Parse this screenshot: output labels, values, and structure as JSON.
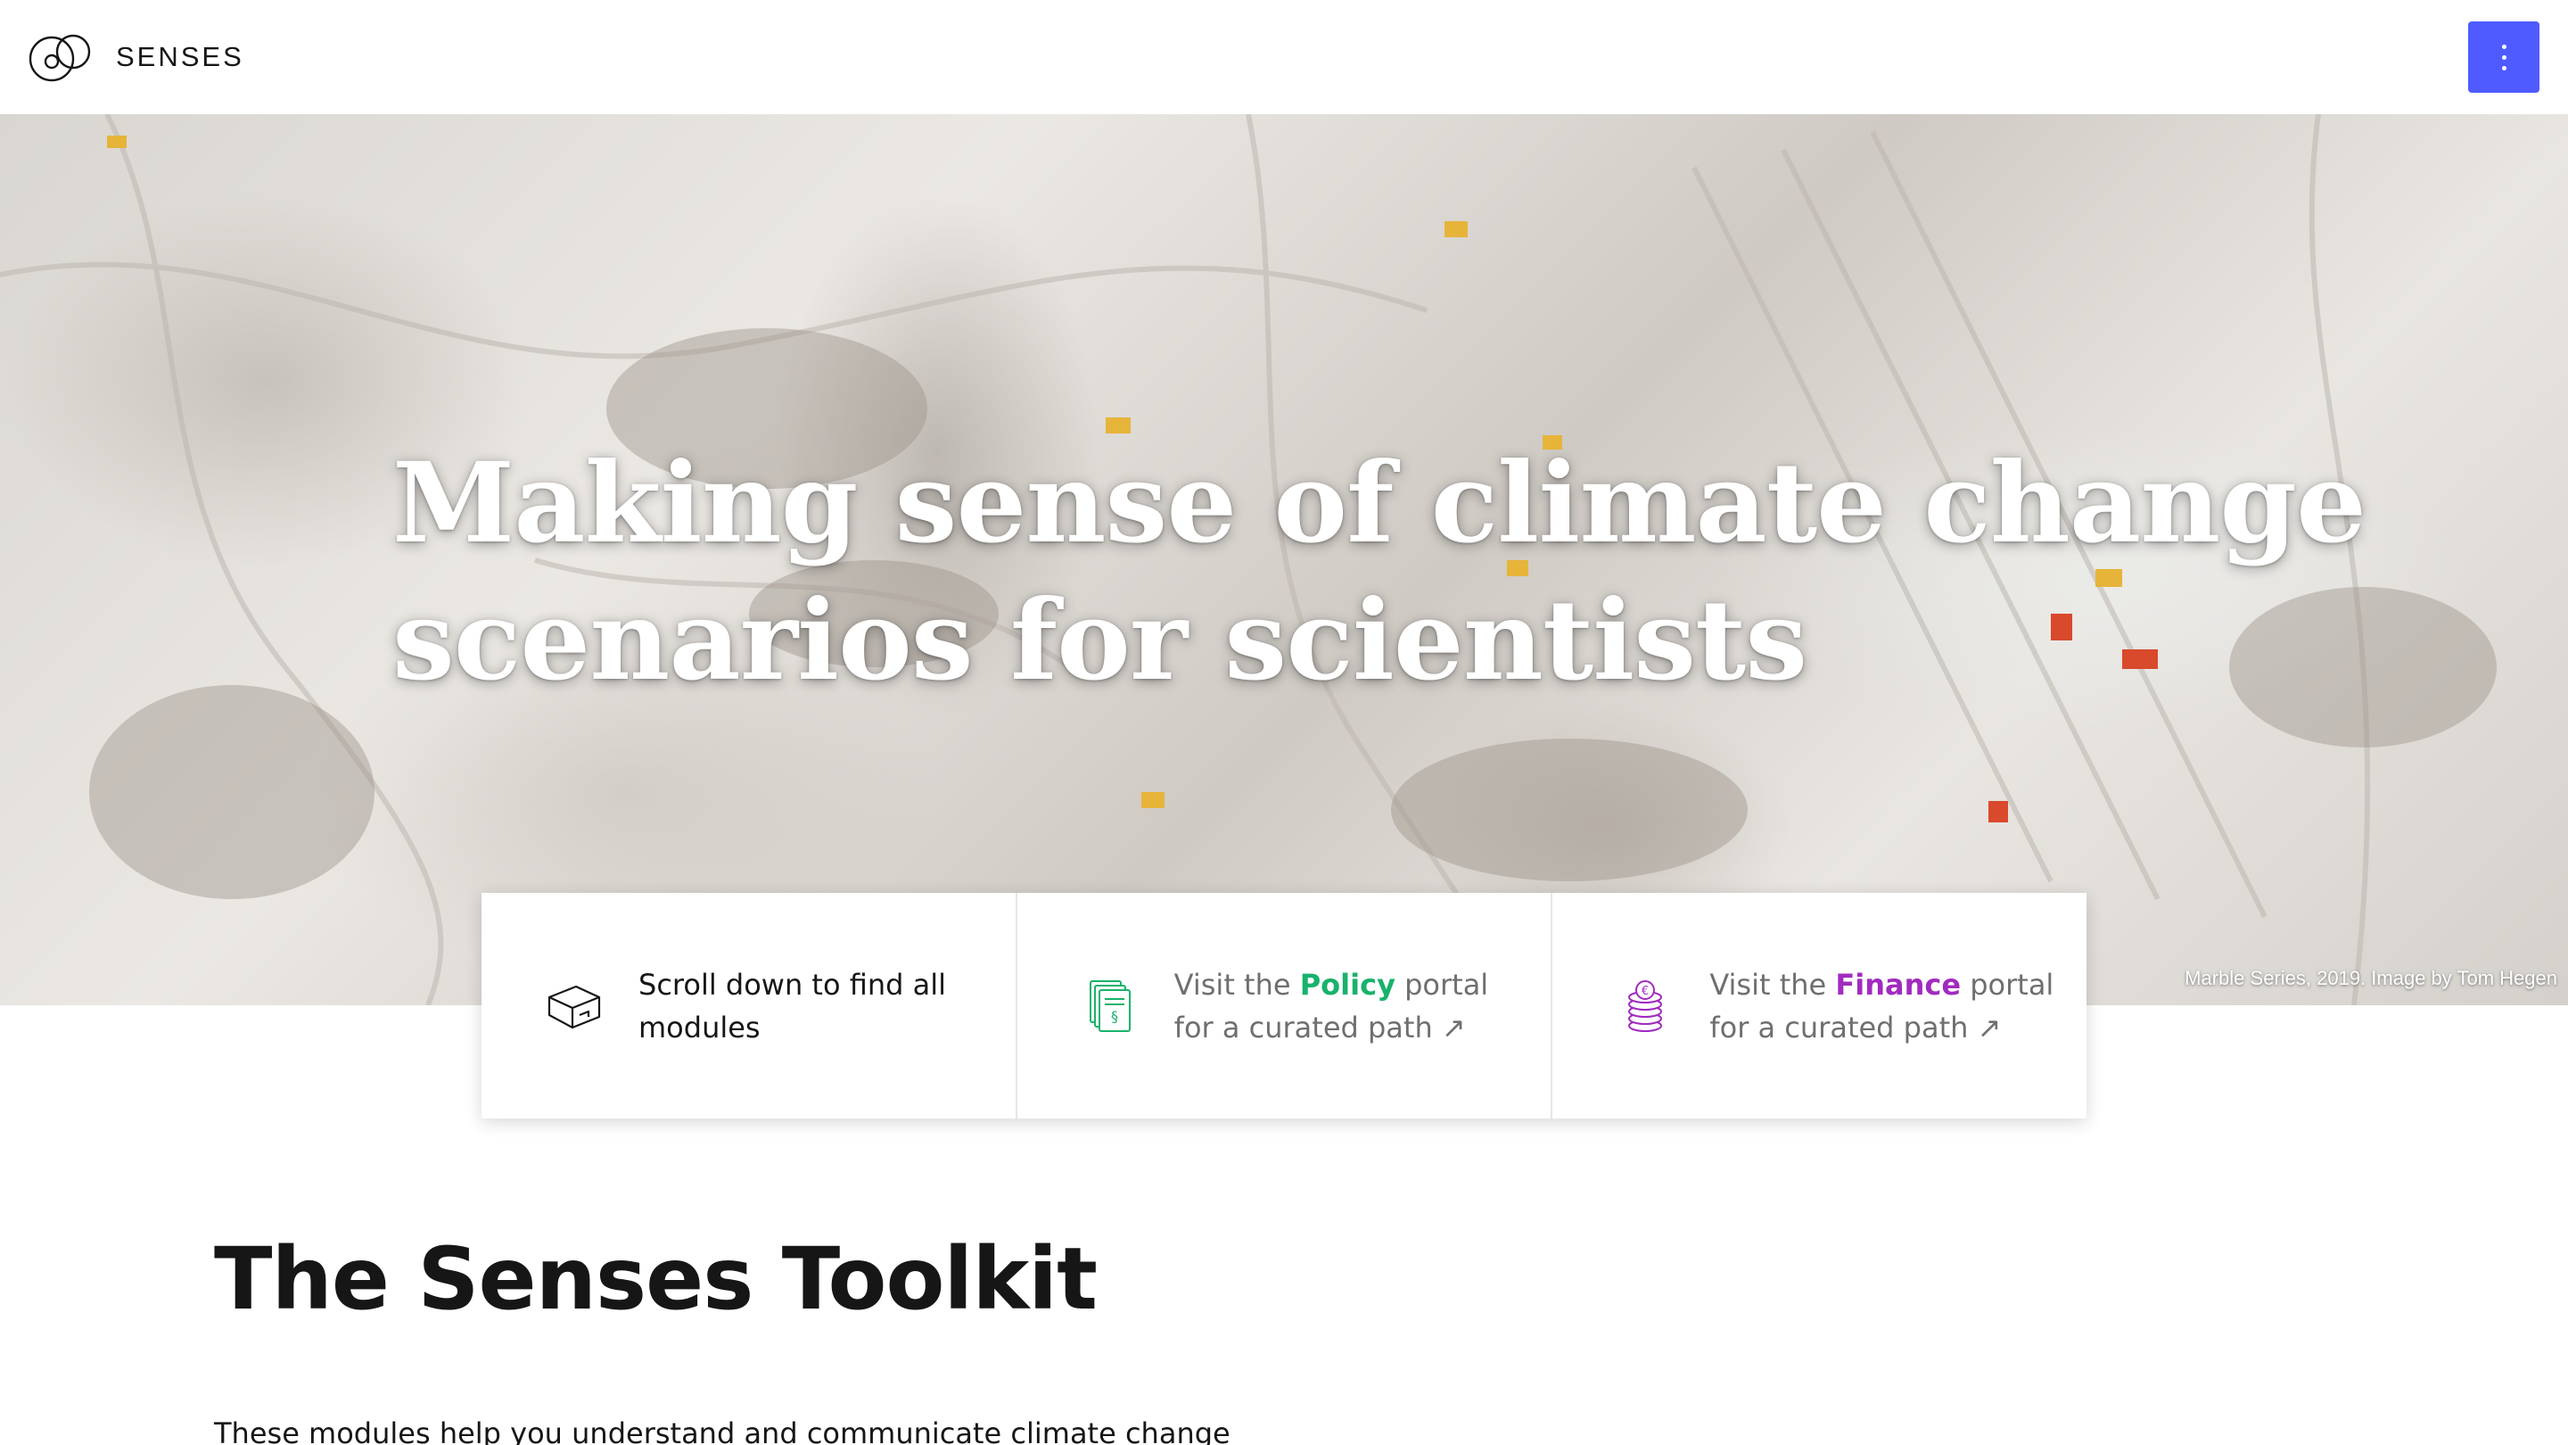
{
  "header": {
    "brand": "SENSES",
    "menu_icon": "more-vertical-icon"
  },
  "hero": {
    "title_line1": "Making sense of climate change",
    "title_line2": "scenarios for scientists",
    "credit": "Marble Series, 2019. Image by Tom Hegen"
  },
  "cards": [
    {
      "icon": "box-icon",
      "text_line1": "Scroll down to find all",
      "text_line2": "modules"
    },
    {
      "icon": "policy-documents-icon",
      "prefix": "Visit the ",
      "highlight": "Policy",
      "suffix": " portal",
      "text_line2": "for a curated path ↗",
      "highlight_color": "#18b26b"
    },
    {
      "icon": "finance-coins-icon",
      "prefix": "Visit the ",
      "highlight": "Finance",
      "suffix": " portal",
      "text_line2": "for a curated path ↗",
      "highlight_color": "#a12bbf"
    }
  ],
  "section": {
    "title": "The Senses Toolkit",
    "body": "These modules help you understand and communicate climate change"
  },
  "colors": {
    "accent": "#4f5bff",
    "policy": "#18b26b",
    "finance": "#a12bbf"
  }
}
